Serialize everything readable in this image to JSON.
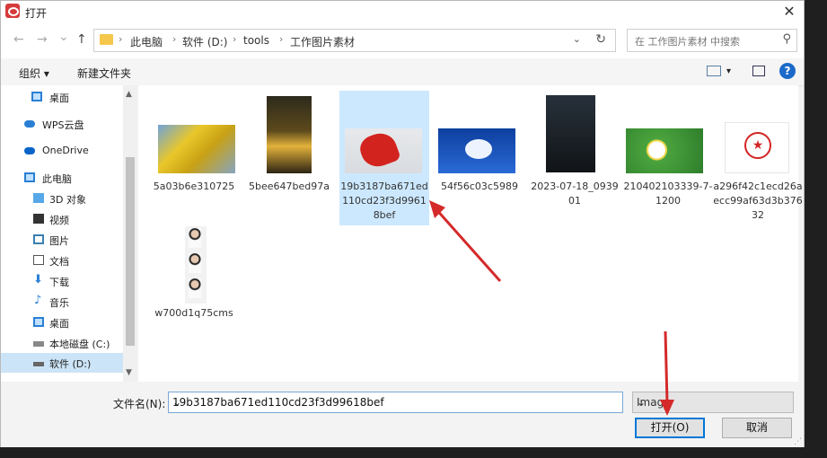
{
  "window": {
    "title": "打开",
    "close_glyph": "✕"
  },
  "nav": {
    "back_glyph": "←",
    "forward_glyph": "→",
    "recent_glyph": "⌄",
    "up_glyph": "↑",
    "breadcrumbs": [
      "此电脑",
      "软件 (D:)",
      "tools",
      "工作图片素材"
    ],
    "separator": "›",
    "dropdown_glyph": "⌄",
    "refresh_glyph": "↻",
    "search_placeholder": "在 工作图片素材 中搜索",
    "search_glyph": "⚲"
  },
  "toolbar": {
    "organize_label": "组织 ▾",
    "new_folder_label": "新建文件夹",
    "view_dropdown_glyph": "▾",
    "help_glyph": "?"
  },
  "sidebar": {
    "items": [
      {
        "label": "桌面",
        "icon": "desktop-icon",
        "indent": 1
      },
      {
        "label": "WPS云盘",
        "icon": "cloud-icon",
        "indent": 1
      },
      {
        "label": "OneDrive",
        "icon": "onedrive-icon",
        "indent": 1
      },
      {
        "label": "此电脑",
        "icon": "computer-icon",
        "indent": 1
      },
      {
        "label": "3D 对象",
        "icon": "3d-objects-icon",
        "indent": 2
      },
      {
        "label": "视频",
        "icon": "video-icon",
        "indent": 2
      },
      {
        "label": "图片",
        "icon": "pictures-icon",
        "indent": 2
      },
      {
        "label": "文档",
        "icon": "documents-icon",
        "indent": 2
      },
      {
        "label": "下载",
        "icon": "download-icon",
        "indent": 2
      },
      {
        "label": "音乐",
        "icon": "music-icon",
        "indent": 2
      },
      {
        "label": "桌面",
        "icon": "desktop-icon",
        "indent": 2
      },
      {
        "label": "本地磁盘 (C:)",
        "icon": "drive-icon",
        "indent": 2
      },
      {
        "label": "软件 (D:)",
        "icon": "drive-icon",
        "indent": 2,
        "selected": true
      }
    ],
    "scroll_up_glyph": "▲",
    "scroll_down_glyph": "▼"
  },
  "files": [
    {
      "name": "5a03b6e310725",
      "thumb": "ginkgo-photo"
    },
    {
      "name": "5bee647bed97a",
      "thumb": "flowers-photo"
    },
    {
      "name": "19b3187ba671ed110cd23f3d99618bef",
      "thumb": "maple-leaf-photo",
      "selected": true
    },
    {
      "name": "54f56c03c5989",
      "thumb": "cloud-heart-photo"
    },
    {
      "name": "2023-07-18_093901",
      "thumb": "dark-poster-photo"
    },
    {
      "name": "210402103339-7-1200",
      "thumb": "daisy-photo"
    },
    {
      "name": "a296f42c1ecd26aecc99af63d3b37632",
      "thumb": "red-stamp-image"
    },
    {
      "name": "w700d1q75cms",
      "thumb": "id-portrait-photo"
    }
  ],
  "bottom": {
    "filename_label": "文件名(N):",
    "filename_value": "19b3187ba671ed110cd23f3d99618bef",
    "filetype_value": "Imag",
    "dropdown_glyph": "⌄",
    "open_label": "打开(O)",
    "cancel_label": "取消",
    "grip_glyph": "⋰"
  },
  "colors": {
    "accent": "#0078d7",
    "selection": "#cce8ff",
    "annotation_arrow": "#d42a2a"
  }
}
